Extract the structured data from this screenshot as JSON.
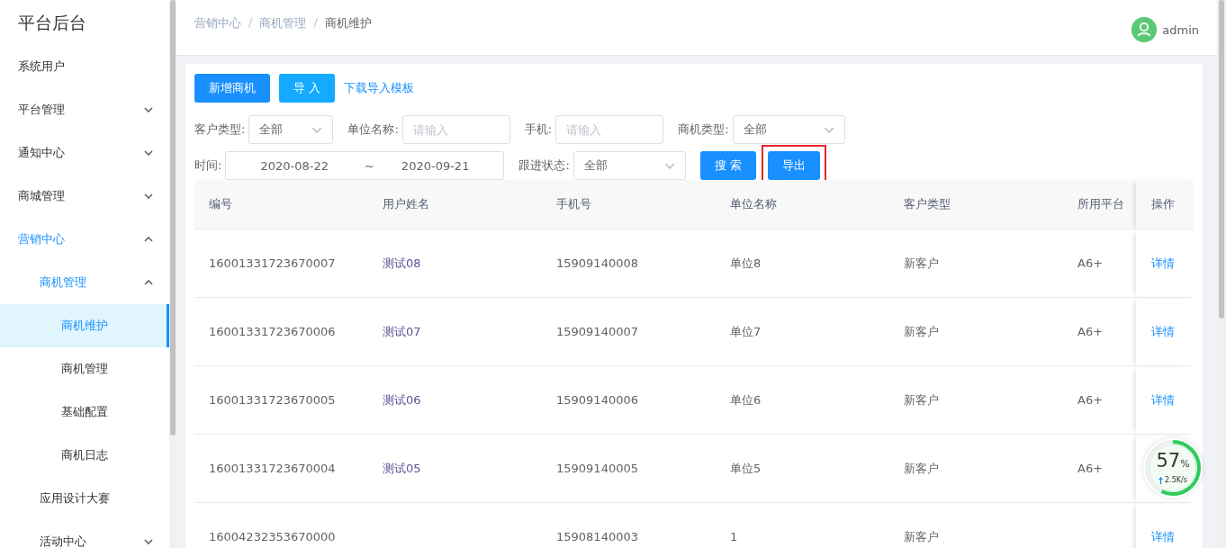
{
  "sidebar": {
    "title": "平台后台",
    "items": [
      {
        "label": "系统用户",
        "selected": false
      },
      {
        "label": "平台管理",
        "selected": false,
        "expanded": false
      },
      {
        "label": "通知中心",
        "selected": false,
        "expanded": false
      },
      {
        "label": "商城管理",
        "selected": false,
        "expanded": false
      },
      {
        "label": "营销中心",
        "selected": false,
        "expanded": true,
        "children": [
          {
            "label": "商机管理",
            "selected": false,
            "expanded": true,
            "children": [
              {
                "label": "商机维护",
                "selected": true
              },
              {
                "label": "商机管理",
                "selected": false
              },
              {
                "label": "基础配置",
                "selected": false
              },
              {
                "label": "商机日志",
                "selected": false
              }
            ]
          },
          {
            "label": "应用设计大赛",
            "selected": false
          },
          {
            "label": "活动中心",
            "selected": false,
            "expanded": false
          }
        ]
      }
    ]
  },
  "header": {
    "breadcrumb": [
      "营销中心",
      "商机管理",
      "商机维护"
    ],
    "separator": "/",
    "user": "admin"
  },
  "actions": [
    {
      "label": "新增商机",
      "kind": "primary"
    },
    {
      "label": "导 入",
      "kind": "secondary"
    },
    {
      "label": "下载导入模板",
      "kind": "link"
    }
  ],
  "filter_rows": [
    [
      {
        "kind": "select",
        "label": "客户类型:",
        "value": "全部"
      },
      {
        "kind": "input",
        "label": "单位名称:",
        "placeholder": "请输入"
      },
      {
        "kind": "input",
        "label": "手机:",
        "placeholder": "请输入"
      },
      {
        "kind": "select",
        "label": "商机类型:",
        "value": "全部"
      }
    ],
    [
      {
        "kind": "daterange",
        "label": "时间:",
        "start": "2020-08-22",
        "separator": "~",
        "end": "2020-09-21"
      },
      {
        "kind": "select",
        "label": "跟进状态:",
        "value": "全部"
      },
      {
        "kind": "button",
        "label": "搜 索",
        "highlighted": false
      },
      {
        "kind": "button",
        "label": "导出",
        "highlighted": true
      }
    ]
  ],
  "table": {
    "columns": [
      "编号",
      "用户姓名",
      "手机号",
      "单位名称",
      "客户类型",
      "所用平台",
      "操作"
    ],
    "rows": [
      {
        "cells": [
          "16001331723670007",
          "测试08",
          "15909140008",
          "单位8",
          "新客户",
          "A6+"
        ],
        "action": "详情"
      },
      {
        "cells": [
          "16001331723670006",
          "测试07",
          "15909140007",
          "单位7",
          "新客户",
          "A6+"
        ],
        "action": "详情"
      },
      {
        "cells": [
          "16001331723670005",
          "测试06",
          "15909140006",
          "单位6",
          "新客户",
          "A6+"
        ],
        "action": "详情"
      },
      {
        "cells": [
          "16001331723670004",
          "测试05",
          "15909140005",
          "单位5",
          "新客户",
          "A6+"
        ]
      },
      {
        "cells": [
          "16004232353670000",
          "",
          "15908140003",
          "1",
          "新客户",
          ""
        ],
        "action": "详情"
      }
    ]
  },
  "speed_widget": {
    "percent": "57",
    "unit": "%",
    "speed": "2.5K/s",
    "level": 0.57
  }
}
